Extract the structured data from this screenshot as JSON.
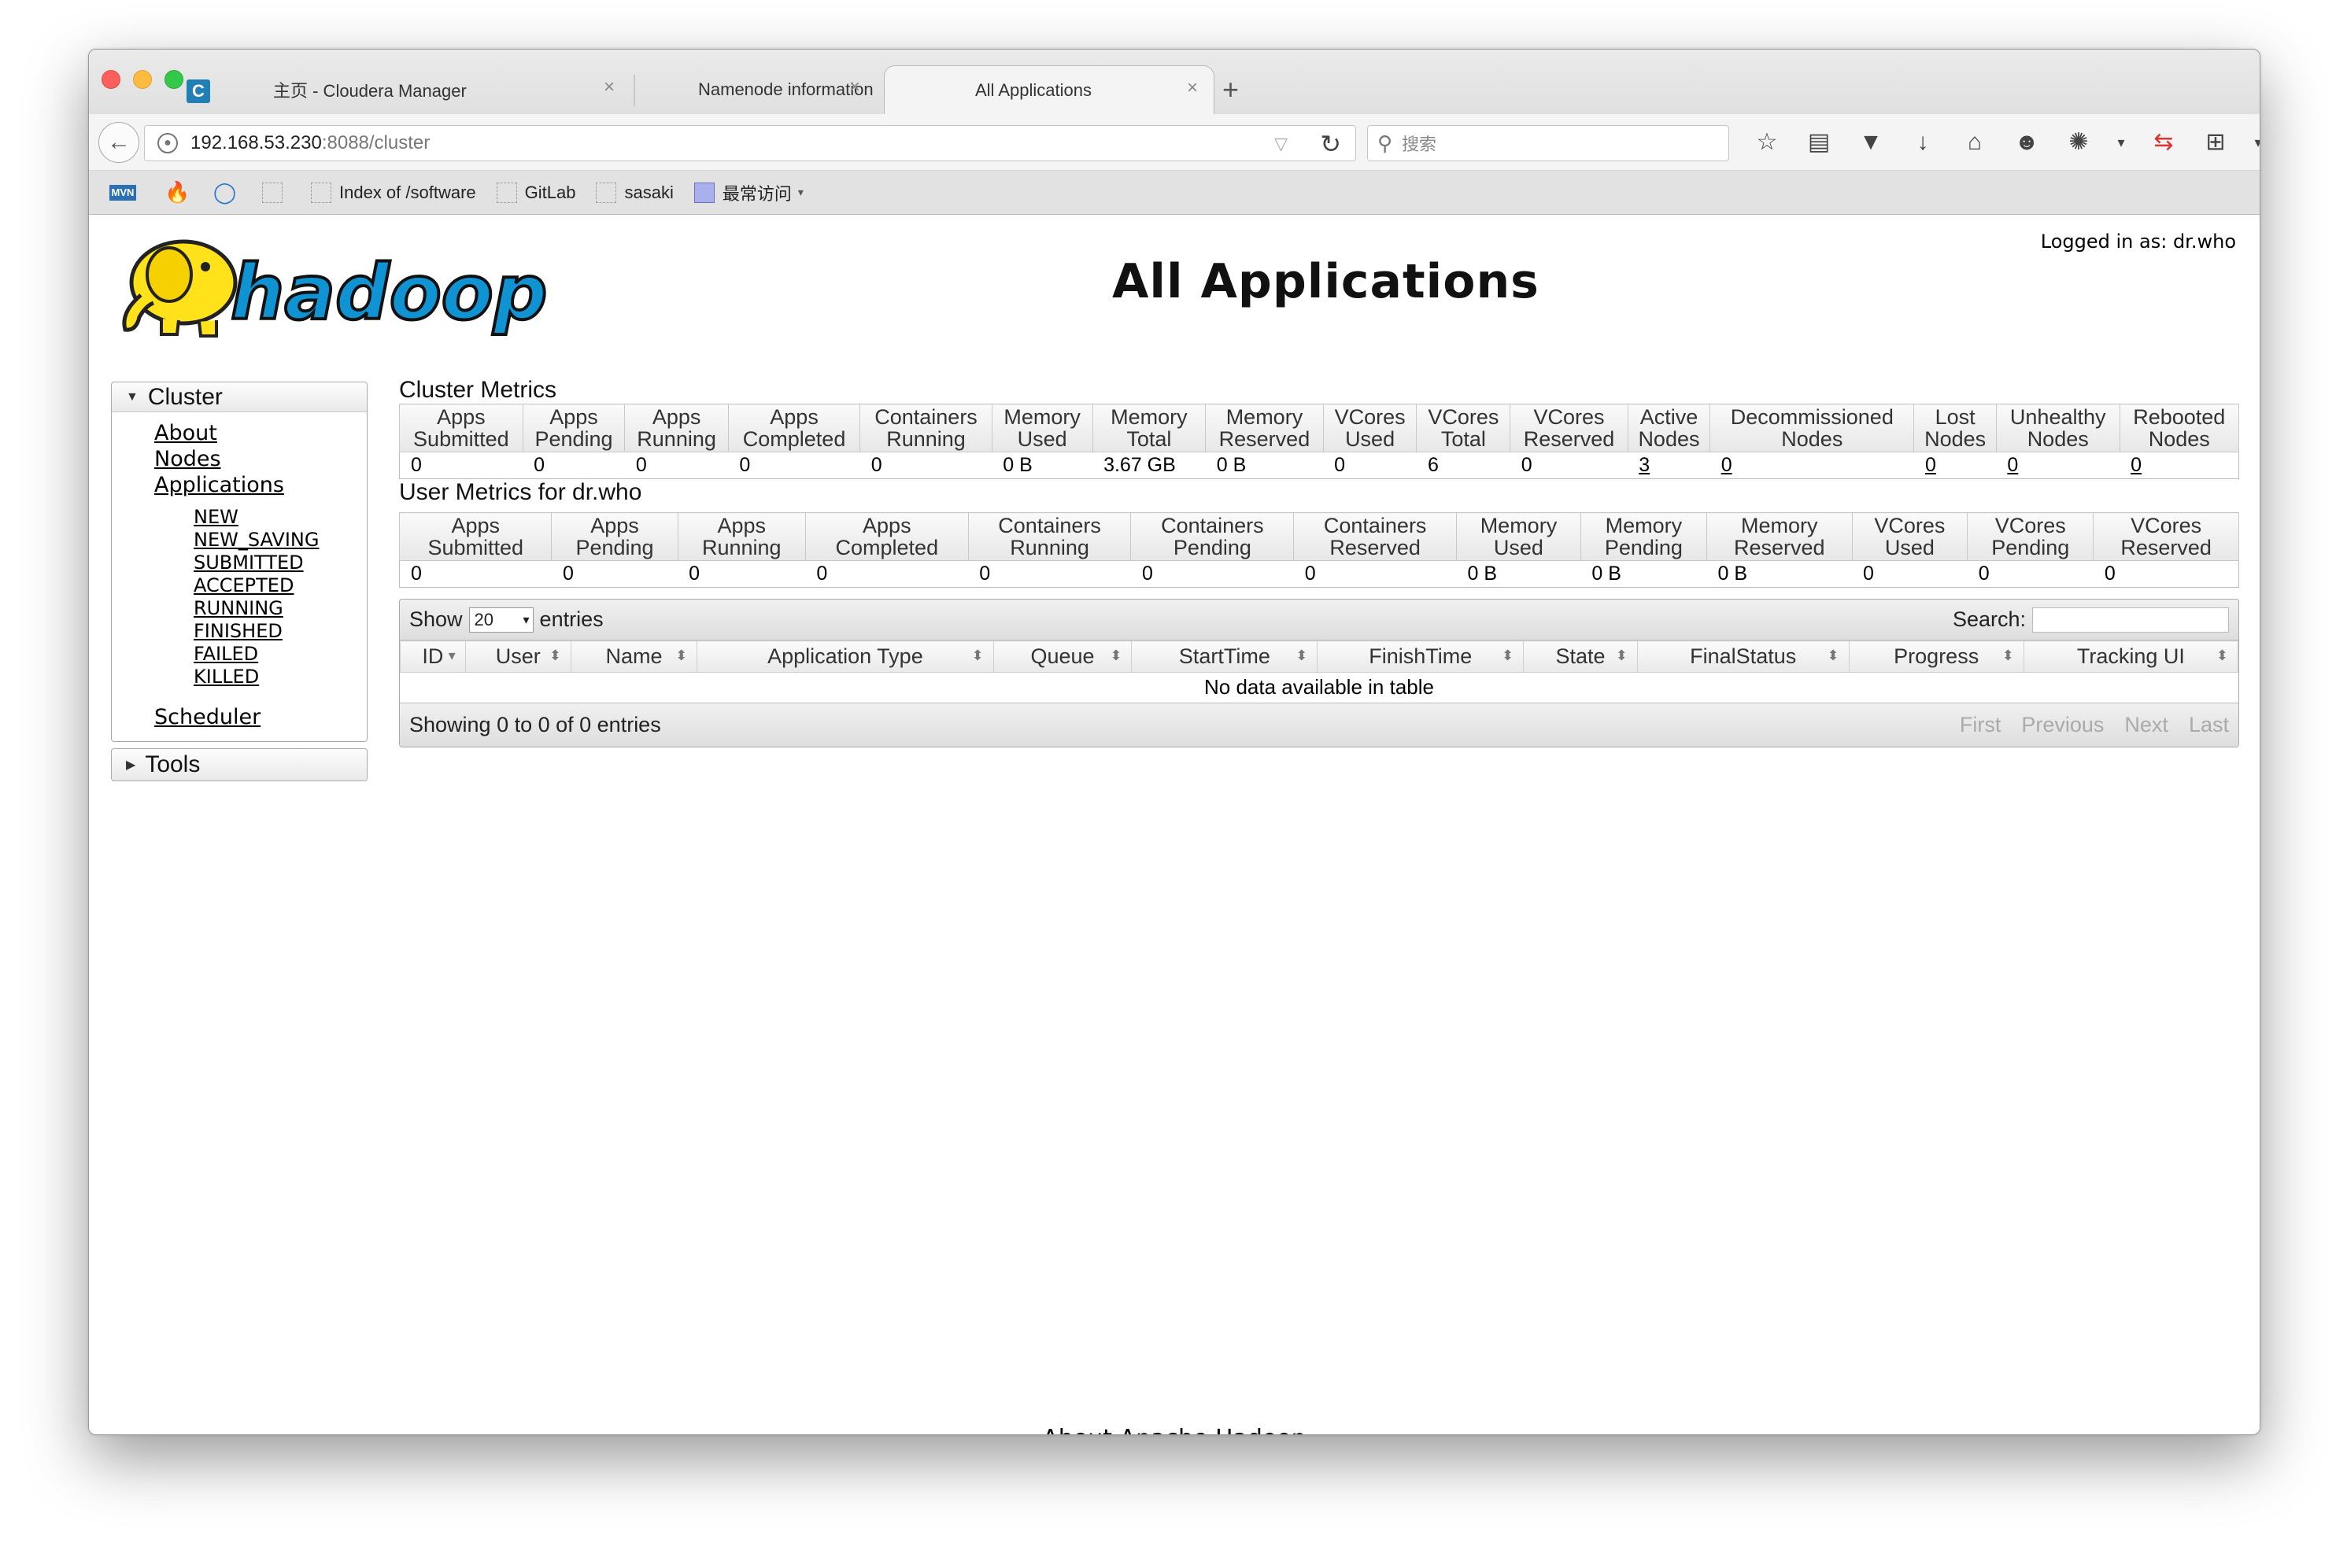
{
  "browser": {
    "tabs": [
      {
        "label": "主页 - Cloudera Manager"
      },
      {
        "label": "Namenode information"
      },
      {
        "label": "All Applications"
      }
    ],
    "url": {
      "host": "192.168.53.230",
      "rest": ":8088/cluster"
    },
    "search_placeholder": "搜索",
    "bookmarks": [
      {
        "label": "",
        "icon": "mvn-icon"
      },
      {
        "label": "",
        "icon": "fire-icon"
      },
      {
        "label": "",
        "icon": "ie-icon"
      },
      {
        "label": "",
        "icon": "blank-icon"
      },
      {
        "label": "Index of /software",
        "icon": "page-icon"
      },
      {
        "label": "GitLab",
        "icon": "page-icon"
      },
      {
        "label": "sasaki",
        "icon": "page-icon"
      },
      {
        "label": "最常访问",
        "icon": "folder-icon"
      }
    ]
  },
  "header": {
    "logged_in": "Logged in as: dr.who",
    "title": "All Applications",
    "logo_text": "hadoop"
  },
  "sidebar": {
    "cluster_label": "Cluster",
    "links": [
      "About",
      "Nodes",
      "Applications"
    ],
    "app_states": [
      "NEW",
      "NEW_SAVING",
      "SUBMITTED",
      "ACCEPTED",
      "RUNNING",
      "FINISHED",
      "FAILED",
      "KILLED"
    ],
    "scheduler_label": "Scheduler",
    "tools_label": "Tools"
  },
  "cluster_metrics": {
    "title": "Cluster Metrics",
    "headers": [
      [
        "Apps",
        "Submitted"
      ],
      [
        "Apps",
        "Pending"
      ],
      [
        "Apps",
        "Running"
      ],
      [
        "Apps",
        "Completed"
      ],
      [
        "Containers",
        "Running"
      ],
      [
        "Memory",
        "Used"
      ],
      [
        "Memory",
        "Total"
      ],
      [
        "Memory",
        "Reserved"
      ],
      [
        "VCores",
        "Used"
      ],
      [
        "VCores",
        "Total"
      ],
      [
        "VCores",
        "Reserved"
      ],
      [
        "Active",
        "Nodes"
      ],
      [
        "Decommissioned",
        "Nodes"
      ],
      [
        "Lost",
        "Nodes"
      ],
      [
        "Unhealthy",
        "Nodes"
      ],
      [
        "Rebooted",
        "Nodes"
      ]
    ],
    "values": [
      "0",
      "0",
      "0",
      "0",
      "0",
      "0 B",
      "3.67 GB",
      "0 B",
      "0",
      "6",
      "0",
      "3",
      "0",
      "0",
      "0",
      "0"
    ],
    "linked": [
      false,
      false,
      false,
      false,
      false,
      false,
      false,
      false,
      false,
      false,
      false,
      true,
      true,
      true,
      true,
      true
    ]
  },
  "user_metrics": {
    "title": "User Metrics for dr.who",
    "headers": [
      [
        "Apps",
        "Submitted"
      ],
      [
        "Apps",
        "Pending"
      ],
      [
        "Apps",
        "Running"
      ],
      [
        "Apps",
        "Completed"
      ],
      [
        "Containers",
        "Running"
      ],
      [
        "Containers",
        "Pending"
      ],
      [
        "Containers",
        "Reserved"
      ],
      [
        "Memory",
        "Used"
      ],
      [
        "Memory",
        "Pending"
      ],
      [
        "Memory",
        "Reserved"
      ],
      [
        "VCores",
        "Used"
      ],
      [
        "VCores",
        "Pending"
      ],
      [
        "VCores",
        "Reserved"
      ]
    ],
    "values": [
      "0",
      "0",
      "0",
      "0",
      "0",
      "0",
      "0",
      "0 B",
      "0 B",
      "0 B",
      "0",
      "0",
      "0"
    ]
  },
  "applications_table": {
    "show_label": "Show",
    "page_length": "20",
    "entries_label": "entries",
    "search_label": "Search:",
    "columns": [
      "ID",
      "User",
      "Name",
      "Application Type",
      "Queue",
      "StartTime",
      "FinishTime",
      "State",
      "FinalStatus",
      "Progress",
      "Tracking UI"
    ],
    "empty_message": "No data available in table",
    "info": "Showing 0 to 0 of 0 entries",
    "pager": [
      "First",
      "Previous",
      "Next",
      "Last"
    ]
  },
  "footer": {
    "link": "About Apache Hadoop"
  }
}
